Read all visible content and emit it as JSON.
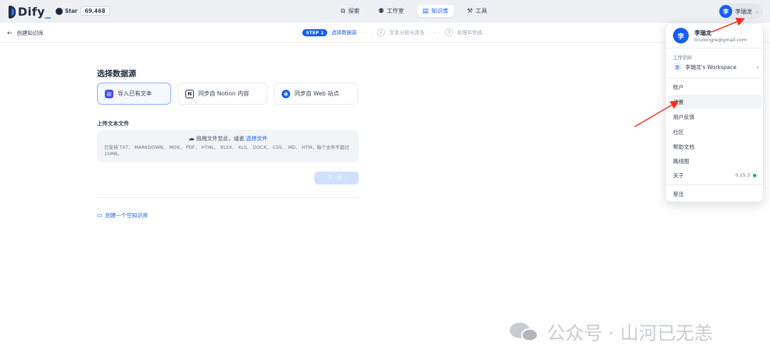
{
  "topbar": {
    "brand": "Dify",
    "github_label": "Star",
    "github_count": "69,468",
    "nav": [
      {
        "label": "探索",
        "icon": "compass-icon"
      },
      {
        "label": "工作室",
        "icon": "robot-icon"
      },
      {
        "label": "知识库",
        "icon": "book-icon",
        "active": true
      },
      {
        "label": "工具",
        "icon": "hammer-icon"
      }
    ],
    "user": {
      "avatar": "李",
      "name": "李瑞龙"
    }
  },
  "subheader": {
    "back_label": "创建知识库",
    "step1_badge": "STEP 1",
    "step1_label": "选择数据源",
    "step2_num": "2",
    "step2_label": "文本分段与清洗",
    "step3_num": "3",
    "step3_label": "处理并完成"
  },
  "main": {
    "title": "选择数据源",
    "sources": [
      {
        "label": "导入已有文本",
        "icon": "document-icon",
        "selected": true
      },
      {
        "label": "同步自 Notion 内容",
        "icon": "notion-icon"
      },
      {
        "label": "同步自 Web 站点",
        "icon": "web-icon"
      }
    ],
    "upload_label": "上传文本文件",
    "drop_text": "拖拽文件至此，或者",
    "drop_link": "选择文件",
    "drop_help": "已支持 TXT、 MARKDOWN、 MDX、 PDF、 HTML、 XLSX、 XLS、 DOCX、 CSV、 MD、 HTM，每个文件不超过 15MB。",
    "next_label": "下一步 ›",
    "empty_link": "创建一个空知识库"
  },
  "dropdown": {
    "name": "李瑞龙",
    "email": "liruilongre@gmail.com",
    "avatar": "李",
    "workspace_label": "工作空间",
    "workspace_badge": "李",
    "workspace_name": "李瑞龙's Workspace",
    "items": [
      "账户",
      "设置",
      "用户反馈",
      "社区",
      "帮助文档",
      "路线图"
    ],
    "about_label": "关于",
    "version": "0.15.3",
    "logout": "登出"
  },
  "watermark": {
    "text": "公众号 · 山河已无恙"
  },
  "colors": {
    "accent": "#155eef",
    "arrow": "#ff2a1a",
    "status_ok": "#12b76a"
  }
}
